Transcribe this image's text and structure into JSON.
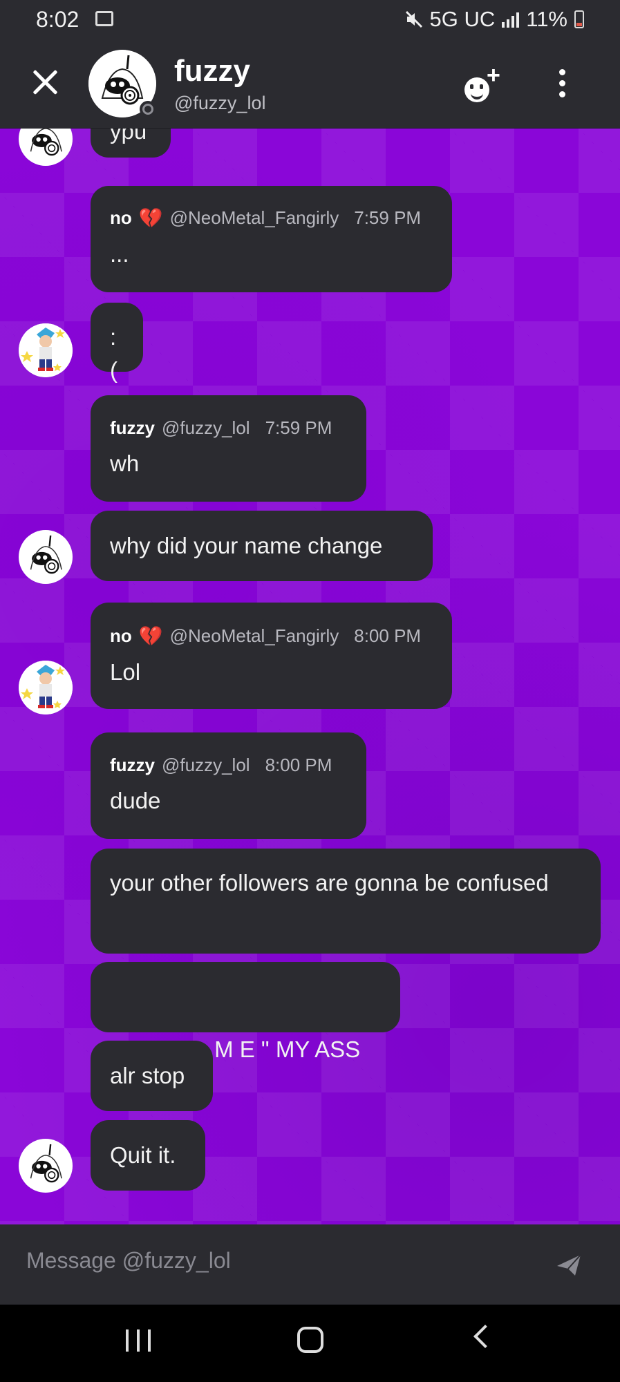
{
  "status_bar": {
    "time": "8:02",
    "network": "5G UC",
    "battery": "11%"
  },
  "header": {
    "name": "fuzzy",
    "handle": "@fuzzy_lol",
    "close_icon": "close-icon",
    "add_friend_icon": "add-friend-icon",
    "more_icon": "more-vertical-icon"
  },
  "messages": [
    {
      "author": "",
      "text": "ypu"
    },
    {
      "author": "no",
      "heart": "💔",
      "handle": "@NeoMetal_Fangirly",
      "time": "7:59 PM",
      "text": "..."
    },
    {
      "author": "",
      "text": ":("
    },
    {
      "author": "fuzzy",
      "handle": "@fuzzy_lol",
      "time": "7:59 PM",
      "text": "wh"
    },
    {
      "author": "",
      "text": "why did your name change"
    },
    {
      "author": "no",
      "heart": "💔",
      "handle": "@NeoMetal_Fangirly",
      "time": "8:00 PM",
      "text": "Lol"
    },
    {
      "author": "fuzzy",
      "handle": "@fuzzy_lol",
      "time": "8:00 PM",
      "text": "dude"
    },
    {
      "author": "",
      "text": "your other followers are gonna be confused"
    },
    {
      "author": "",
      "text": "\" F E A R  M E \" MY ASS"
    },
    {
      "author": "",
      "text": "alr stop"
    },
    {
      "author": "",
      "text": "Quit it."
    }
  ],
  "composer": {
    "placeholder": "Message @fuzzy_lol",
    "send_icon": "send-icon"
  },
  "colors": {
    "chat_bg": "#8a06d8",
    "bubble": "#2b2b30",
    "header": "#2b2b30"
  }
}
